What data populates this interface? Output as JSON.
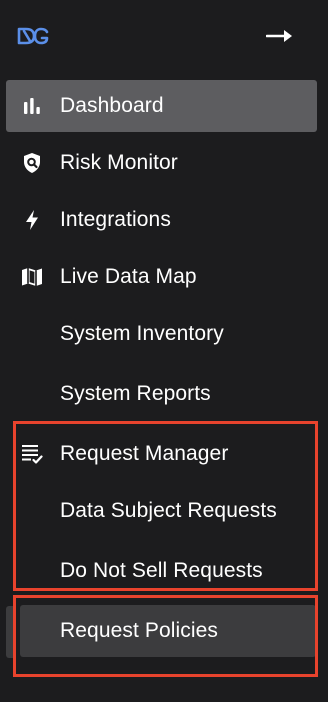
{
  "app": {
    "logo_alt": "DG logo",
    "collapse_icon": "arrow-right-icon"
  },
  "nav": {
    "items": [
      {
        "label": "Dashboard",
        "icon": "bar-chart-icon",
        "state": "active"
      },
      {
        "label": "Risk Monitor",
        "icon": "shield-search-icon",
        "state": "default"
      },
      {
        "label": "Integrations",
        "icon": "lightning-icon",
        "state": "default"
      },
      {
        "label": "Live Data Map",
        "icon": "map-icon",
        "state": "default"
      },
      {
        "label": "System Inventory",
        "icon": "",
        "state": "default"
      },
      {
        "label": "System Reports",
        "icon": "",
        "state": "default"
      },
      {
        "label": "Request Manager",
        "icon": "checklist-icon",
        "state": "default"
      },
      {
        "label": "Data Subject Requests",
        "icon": "",
        "state": "default"
      },
      {
        "label": "Do Not Sell Requests",
        "icon": "",
        "state": "default"
      },
      {
        "label": "Request Policies",
        "icon": "",
        "state": "highlighted"
      }
    ]
  },
  "colors": {
    "background": "#1c1c1e",
    "active_item": "#5d5d60",
    "highlight_item": "#3c3c3e",
    "logo": "#5b8fe8",
    "annotation": "#e8432d"
  }
}
